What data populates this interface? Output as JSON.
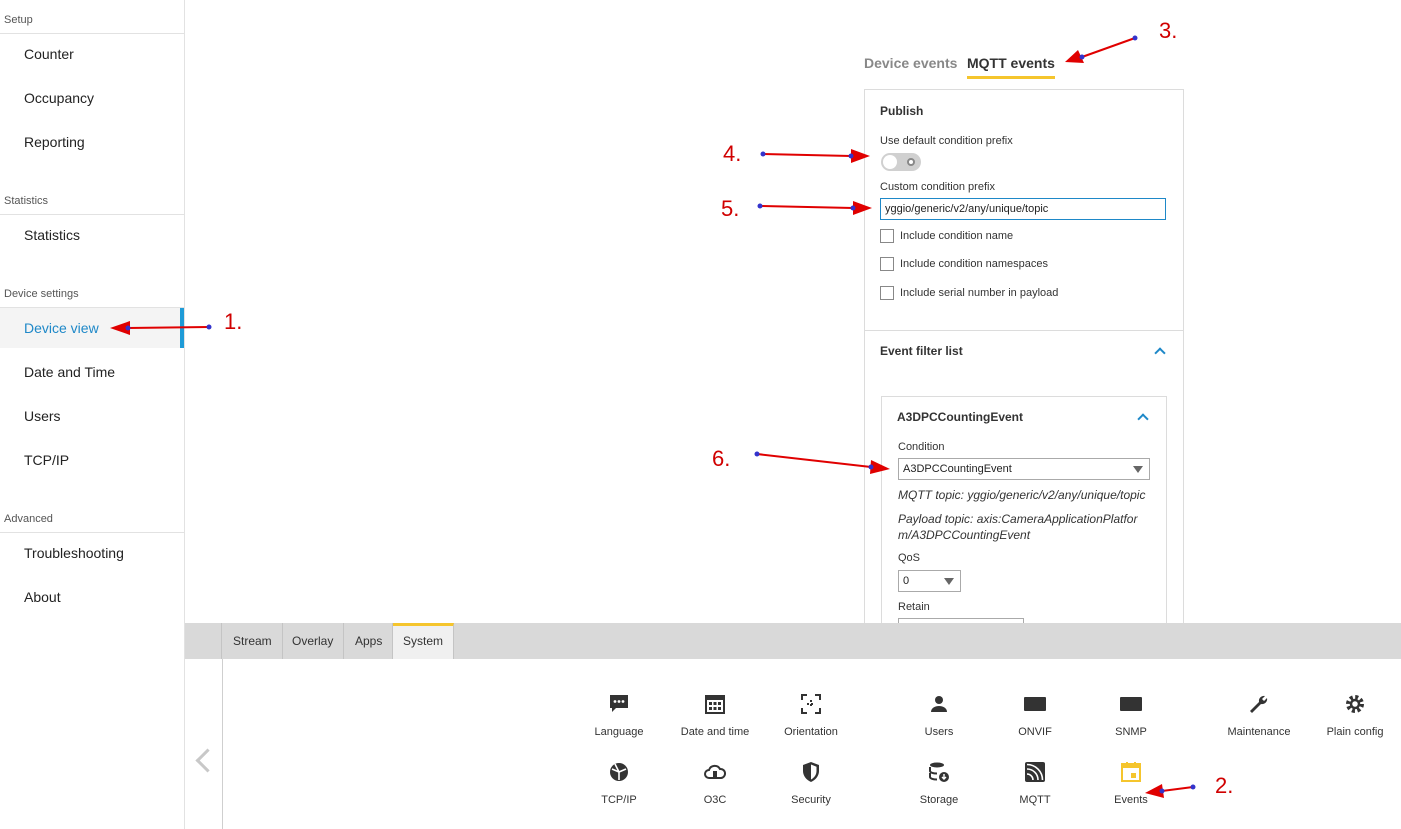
{
  "sidebar": {
    "sections": [
      {
        "label": "Setup"
      },
      {
        "label": "Statistics"
      },
      {
        "label": "Device settings"
      },
      {
        "label": "Advanced"
      }
    ],
    "items": [
      {
        "label": "Counter"
      },
      {
        "label": "Occupancy"
      },
      {
        "label": "Reporting"
      },
      {
        "label": "Statistics"
      },
      {
        "label": "Device view",
        "active": true
      },
      {
        "label": "Date and Time"
      },
      {
        "label": "Users"
      },
      {
        "label": "TCP/IP"
      },
      {
        "label": "Troubleshooting"
      },
      {
        "label": "About"
      }
    ]
  },
  "events_tabs": [
    {
      "label": "Device events"
    },
    {
      "label": "MQTT events",
      "active": true
    }
  ],
  "publish": {
    "title": "Publish",
    "default_prefix_label": "Use default condition prefix",
    "default_prefix_on": false,
    "custom_prefix_label": "Custom condition prefix",
    "custom_prefix_value": "yggio/generic/v2/any/unique/topic",
    "checkboxes": [
      {
        "label": "Include condition name",
        "checked": false
      },
      {
        "label": "Include condition namespaces",
        "checked": false
      },
      {
        "label": "Include serial number in payload",
        "checked": false
      }
    ]
  },
  "event_filter": {
    "title": "Event filter list",
    "item": {
      "title": "A3DPCCountingEvent",
      "condition_label": "Condition",
      "condition_value": "A3DPCCountingEvent",
      "mqtt_topic": "MQTT topic: yggio/generic/v2/any/unique/topic",
      "payload_topic_line1": "Payload topic: axis:CameraApplicationPlatfor",
      "payload_topic_line2": "m/A3DPCCountingEvent",
      "qos_label": "QoS",
      "qos_value": "0",
      "retain_label": "Retain"
    }
  },
  "bottom_tabs": [
    {
      "label": "Stream"
    },
    {
      "label": "Overlay"
    },
    {
      "label": "Apps"
    },
    {
      "label": "System",
      "active": true
    }
  ],
  "system_tiles": [
    {
      "label": "Language",
      "icon": "language-icon"
    },
    {
      "label": "Date and time",
      "icon": "calendar-icon"
    },
    {
      "label": "Orientation",
      "icon": "orientation-icon"
    },
    {
      "label": "Users",
      "icon": "user-icon"
    },
    {
      "label": "ONVIF",
      "icon": "onvif-icon",
      "badge": "Onvif"
    },
    {
      "label": "SNMP",
      "icon": "snmp-icon",
      "badge": "SNMP"
    },
    {
      "label": "Maintenance",
      "icon": "wrench-icon"
    },
    {
      "label": "Plain config",
      "icon": "gear-icon"
    },
    {
      "label": "TCP/IP",
      "icon": "network-icon"
    },
    {
      "label": "O3C",
      "icon": "cloud-icon"
    },
    {
      "label": "Security",
      "icon": "shield-icon"
    },
    {
      "label": "Storage",
      "icon": "storage-icon"
    },
    {
      "label": "MQTT",
      "icon": "mqtt-icon"
    },
    {
      "label": "Events",
      "icon": "events-icon"
    }
  ],
  "annotations": [
    "1.",
    "2.",
    "3.",
    "4.",
    "5.",
    "6."
  ],
  "colors": {
    "accent_blue": "#1e88c8",
    "accent_yellow": "#f5c52d",
    "annotation_red": "#d00000"
  }
}
